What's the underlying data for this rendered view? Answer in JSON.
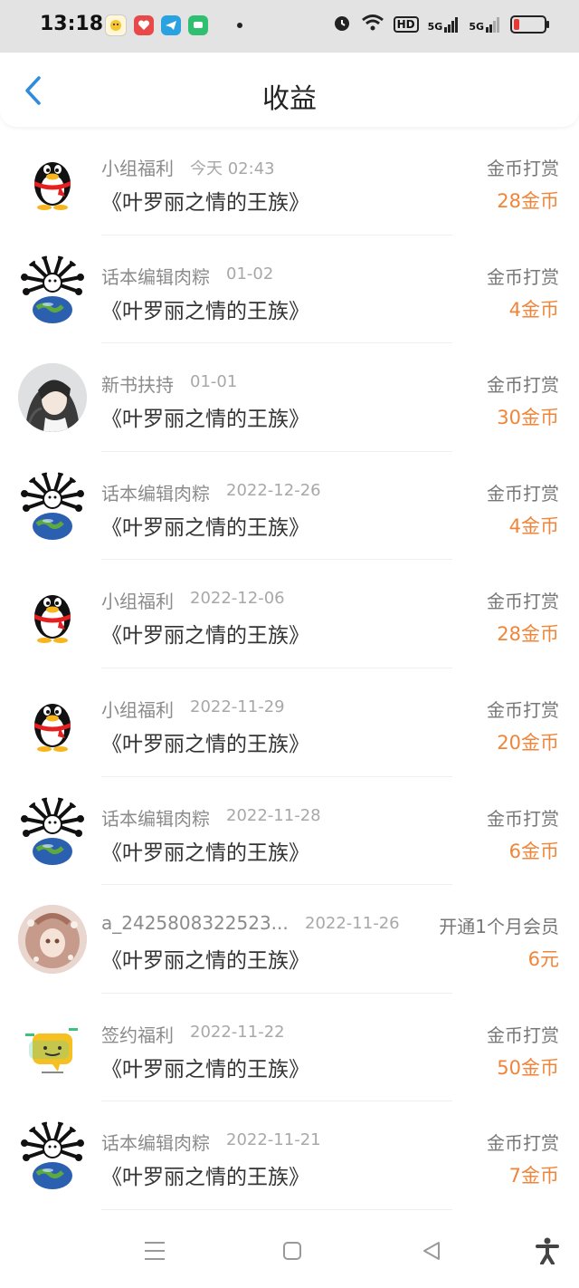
{
  "status_bar": {
    "time": "13:18",
    "icons": [
      "alarm-icon",
      "wifi-icon",
      "hd-icon",
      "5g-signal-icon",
      "5g-signal-icon",
      "battery-icon"
    ],
    "hd_label": "HD",
    "net1": "5G",
    "net2": "5G",
    "battery_level": 0.2
  },
  "header": {
    "title": "收益",
    "back_icon": "chevron-left-icon",
    "accent": "#2f8cdc"
  },
  "rows": [
    {
      "sender": "小组福利",
      "date": "今天 02:43",
      "work": "《叶罗丽之情的王族》",
      "type": "金币打赏",
      "amount": "28金币",
      "avatar": "penguin"
    },
    {
      "sender": "话本编辑肉粽",
      "date": "01-02",
      "work": "《叶罗丽之情的王族》",
      "type": "金币打赏",
      "amount": "4金币",
      "avatar": "spider-globe"
    },
    {
      "sender": "新书扶持",
      "date": "01-01",
      "work": "《叶罗丽之情的王族》",
      "type": "金币打赏",
      "amount": "30金币",
      "avatar": "anime-portrait"
    },
    {
      "sender": "话本编辑肉粽",
      "date": "2022-12-26",
      "work": "《叶罗丽之情的王族》",
      "type": "金币打赏",
      "amount": "4金币",
      "avatar": "spider-globe"
    },
    {
      "sender": "小组福利",
      "date": "2022-12-06",
      "work": "《叶罗丽之情的王族》",
      "type": "金币打赏",
      "amount": "28金币",
      "avatar": "penguin"
    },
    {
      "sender": "小组福利",
      "date": "2022-11-29",
      "work": "《叶罗丽之情的王族》",
      "type": "金币打赏",
      "amount": "20金币",
      "avatar": "penguin"
    },
    {
      "sender": "话本编辑肉粽",
      "date": "2022-11-28",
      "work": "《叶罗丽之情的王族》",
      "type": "金币打赏",
      "amount": "6金币",
      "avatar": "spider-globe"
    },
    {
      "sender": "a_2425808322523...",
      "date": "2022-11-26",
      "work": "《叶罗丽之情的王族》",
      "type": "开通1个月会员",
      "amount": "6元",
      "avatar": "doll-portrait"
    },
    {
      "sender": "签约福利",
      "date": "2022-11-22",
      "work": "《叶罗丽之情的王族》",
      "type": "金币打赏",
      "amount": "50金币",
      "avatar": "chat-bubble"
    },
    {
      "sender": "话本编辑肉粽",
      "date": "2022-11-21",
      "work": "《叶罗丽之情的王族》",
      "type": "金币打赏",
      "amount": "7金币",
      "avatar": "spider-globe"
    }
  ],
  "colors": {
    "amount": "#f0853a",
    "sender": "#8b8b8b",
    "date": "#a8a8a8"
  },
  "nav_bar": {
    "icons": [
      "menu-icon",
      "home-square-icon",
      "back-triangle-icon",
      "accessibility-icon"
    ]
  }
}
